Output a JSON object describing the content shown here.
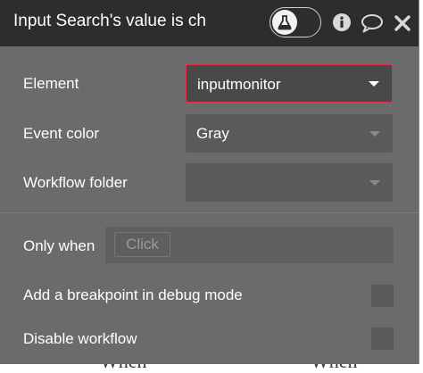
{
  "background": {
    "left_word": "When",
    "right_word": "When"
  },
  "header": {
    "title": "Input Search's value is ch",
    "icons": [
      "flask-icon",
      "info-icon",
      "comment-icon",
      "close-icon"
    ]
  },
  "fields": {
    "element": {
      "label": "Element",
      "value": "inputmonitor"
    },
    "event_color": {
      "label": "Event color",
      "value": "Gray"
    },
    "workflow_folder": {
      "label": "Workflow folder",
      "value": ""
    }
  },
  "condition": {
    "label": "Only when",
    "placeholder": "Click"
  },
  "options": {
    "breakpoint": {
      "label": "Add a breakpoint in debug mode",
      "checked": false
    },
    "disable": {
      "label": "Disable workflow",
      "checked": false
    }
  },
  "colors": {
    "header_bg": "#2d2d2d",
    "panel_bg": "#6b6b6b",
    "field_bg": "#5a5a5a",
    "focus_border": "#e0304a"
  }
}
